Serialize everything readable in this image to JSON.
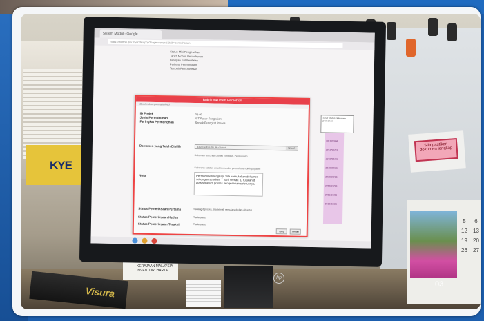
{
  "browser": {
    "tab_title": "Sistem Modul - Google",
    "url": "https://mohon.gov.my/index.php?page=senarai&tab=permohonan"
  },
  "page_info": [
    "Status Misi Pengesahan",
    "Tarikh Mohon Permohonan",
    "Bilangan Fail Penilaian",
    "Perbarui Permohonan",
    "Tempoh Pemprosesan"
  ],
  "modal": {
    "title": "Bukti Dokumen Pemohon",
    "address": "https://mohon.gov.my/upload",
    "headers": [
      "ID Projek",
      "Jenis Permohonan",
      "Peringkat Permohonan"
    ],
    "header_values": [
      "02-00",
      "ICT Pasar Rangkaian",
      "Semak Peringkat Proses"
    ],
    "upload_label": "Dokumen yang Telah Dipilih",
    "file_button": "Choose File  No file chosen",
    "upload_button": "Upload",
    "upload_hint": "Dokumen Sokongan, Bukti Tuntutan, Pengurusan",
    "note_label": "Nota",
    "note_hint": "Sebarang catatan untuk kemaskini permohonan oleh pegawai",
    "note_text": "Permohonan lengkap. Sila kemukakan dokumen sokongan sebelum 7 hari, semak ID rujukan di atas sebelum proses pengesahan seterusnya.",
    "status_labels": [
      "Status Pemeriksaan Pertama",
      "Status Pemeriksaan Kedua",
      "Status Pemeriksaan Terakhir"
    ],
    "status_values": [
      "Sedang diproses, sila semak semula sebelum dihantar",
      "Tiada status",
      "Tiada status"
    ],
    "buttons": [
      "Tutup",
      "Simpan"
    ]
  },
  "list_column": [
    "2019/03/06",
    "2019/03/06",
    "2019/03/06",
    "2019/03/06",
    "2019/03/06",
    "2019/03/06",
    "2019/03/06",
    "2019/03/06",
    "2019/03/06",
    "2019/03/06"
  ],
  "tooltip": "Lihat status dokumen pemohon",
  "desk": {
    "brand_box_text": "KYE",
    "note_text": "Sila pastikan dokumen lengkap",
    "sticker_text": "KERAJAAN MALAYSIA INVENTORI HARTA",
    "book_text": "Visura",
    "monitor_brand": "hp"
  },
  "calendar": {
    "month": "03",
    "days": [
      "5",
      "6",
      "12",
      "13",
      "19",
      "20",
      "26",
      "27"
    ]
  },
  "colors": {
    "frame_bg": "#1d5fae",
    "modal_accent": "#e8404b",
    "pink_column": "#e8c6e8"
  }
}
